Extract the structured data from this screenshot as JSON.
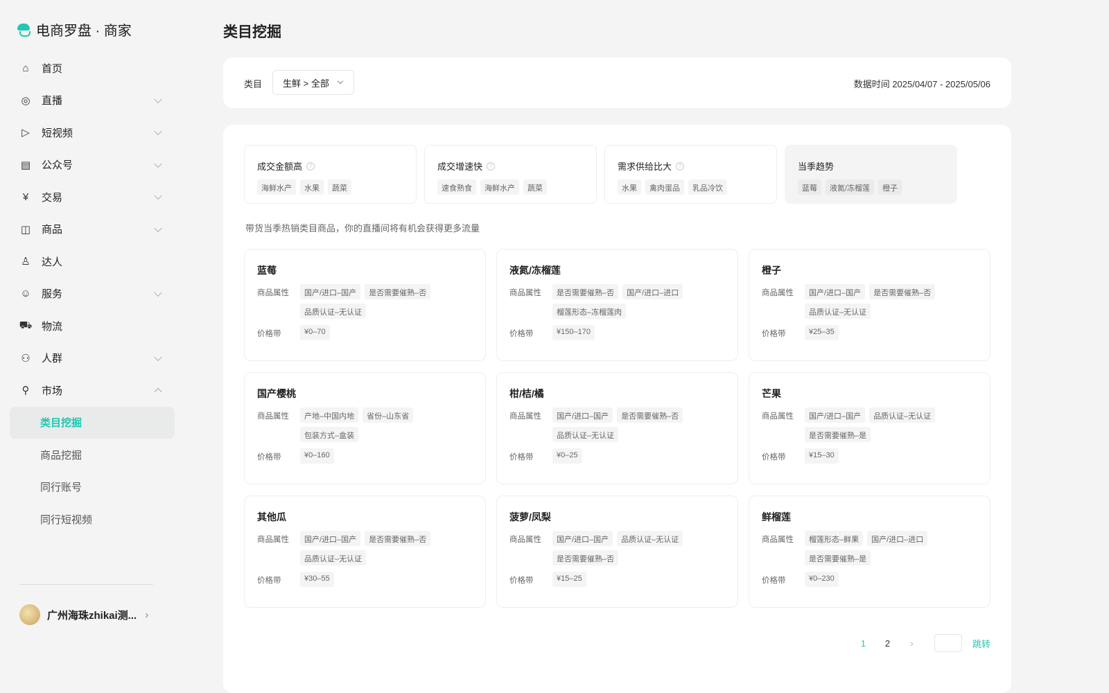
{
  "app": {
    "title": "电商罗盘 · 商家"
  },
  "sidebar": {
    "items": [
      {
        "label": "首页",
        "icon": "home-icon",
        "g": "⌂",
        "chev": ""
      },
      {
        "label": "直播",
        "icon": "live-icon",
        "g": "◎",
        "chev": "down"
      },
      {
        "label": "短视频",
        "icon": "video-play-icon",
        "g": "▷",
        "chev": "down"
      },
      {
        "label": "公众号",
        "icon": "document-icon",
        "g": "▤",
        "chev": "down"
      },
      {
        "label": "交易",
        "icon": "yen-icon",
        "g": "¥",
        "chev": "down"
      },
      {
        "label": "商品",
        "icon": "shopping-bag-icon",
        "g": "◫",
        "chev": "down"
      },
      {
        "label": "达人",
        "icon": "person-icon",
        "g": "♙",
        "chev": ""
      },
      {
        "label": "服务",
        "icon": "smile-icon",
        "g": "☺",
        "chev": "down"
      },
      {
        "label": "物流",
        "icon": "truck-icon",
        "g": "⛟",
        "chev": ""
      },
      {
        "label": "人群",
        "icon": "people-icon",
        "g": "⚇",
        "chev": "down"
      },
      {
        "label": "市场",
        "icon": "location-icon",
        "g": "⚲",
        "chev": "up"
      }
    ],
    "sub_items": [
      "类目挖掘",
      "商品挖掘",
      "同行账号",
      "同行短视频"
    ],
    "active_sub": 0,
    "user": {
      "name": "广州海珠zhikai测...",
      "arrow": "›"
    }
  },
  "page": {
    "title": "类目挖掘"
  },
  "filter": {
    "label": "类目",
    "value": "生鲜 > 全部",
    "date": "数据时间 2025/04/07 - 2025/05/06"
  },
  "stats": [
    {
      "title": "成交金额高",
      "help": true,
      "tags": [
        "海鲜水产",
        "水果",
        "蔬菜"
      ]
    },
    {
      "title": "成交增速快",
      "help": true,
      "tags": [
        "速食熟食",
        "海鲜水产",
        "蔬菜"
      ]
    },
    {
      "title": "需求供给比大",
      "help": true,
      "tags": [
        "水果",
        "禽肉蛋品",
        "乳品冷饮"
      ]
    },
    {
      "title": "当季趋势",
      "help": false,
      "tags": [
        "蓝莓",
        "液氮/冻榴莲",
        "橙子"
      ]
    }
  ],
  "hint": "带货当季热销类目商品，你的直播间将有机会获得更多流量",
  "labels": {
    "attr": "商品属性",
    "price": "价格带"
  },
  "products": [
    {
      "name": "蓝莓",
      "attrs": [
        "国产/进口–国产",
        "是否需要催熟–否",
        "品质认证–无认证"
      ],
      "price": "¥0–70"
    },
    {
      "name": "液氮/冻榴莲",
      "attrs": [
        "是否需要催熟–否",
        "国产/进口–进口",
        "榴莲形态–冻榴莲肉"
      ],
      "price": "¥150–170"
    },
    {
      "name": "橙子",
      "attrs": [
        "国产/进口–国产",
        "是否需要催熟–否",
        "品质认证–无认证"
      ],
      "price": "¥25–35"
    },
    {
      "name": "国产樱桃",
      "attrs": [
        "产地–中国内地",
        "省份–山东省",
        "包装方式–盒装"
      ],
      "price": "¥0–160"
    },
    {
      "name": "柑/桔/橘",
      "attrs": [
        "国产/进口–国产",
        "是否需要催熟–否",
        "品质认证–无认证"
      ],
      "price": "¥0–25"
    },
    {
      "name": "芒果",
      "attrs": [
        "国产/进口–国产",
        "品质认证–无认证",
        "是否需要催熟–是"
      ],
      "price": "¥15–30"
    },
    {
      "name": "其他瓜",
      "attrs": [
        "国产/进口–国产",
        "是否需要催熟–否",
        "品质认证–无认证"
      ],
      "price": "¥30–55"
    },
    {
      "name": "菠萝/凤梨",
      "attrs": [
        "国产/进口–国产",
        "品质认证–无认证",
        "是否需要催熟–否"
      ],
      "price": "¥15–25"
    },
    {
      "name": "鲜榴莲",
      "attrs": [
        "榴莲形态–鲜果",
        "国产/进口–进口",
        "是否需要催熟–是"
      ],
      "price": "¥0–230"
    }
  ],
  "pagination": {
    "pages": [
      "1",
      "2"
    ],
    "current": "1",
    "next": "›",
    "jump_label": "跳转",
    "jump_value": ""
  },
  "colors": {
    "accent": "#1ec8b4"
  }
}
